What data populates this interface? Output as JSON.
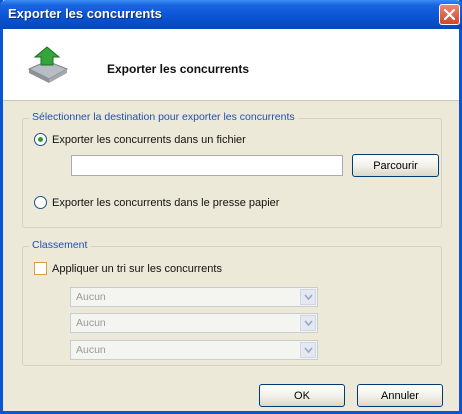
{
  "window": {
    "title": "Exporter les concurrents"
  },
  "header": {
    "title": "Exporter les concurrents",
    "icon": "export-green-arrow-icon"
  },
  "destination": {
    "legend": "Sélectionner la destination pour exporter les concurrents",
    "option_file_label": "Exporter les concurrents dans un fichier",
    "option_file_checked": true,
    "file_path_value": "",
    "browse_label": "Parcourir",
    "option_clipboard_label": "Exporter les concurrents dans le presse papier",
    "option_clipboard_checked": false
  },
  "sorting": {
    "legend": "Classement",
    "apply_sort_label": "Appliquer un tri sur les concurrents",
    "apply_sort_checked": false,
    "sort_fields": [
      {
        "value": "Aucun"
      },
      {
        "value": "Aucun"
      },
      {
        "value": "Aucun"
      }
    ]
  },
  "footer": {
    "ok_label": "OK",
    "cancel_label": "Annuler"
  },
  "colors": {
    "titlebar": "#0a55d6",
    "legend_text": "#1e4fb5",
    "dialog_bg": "#ece9d8"
  }
}
